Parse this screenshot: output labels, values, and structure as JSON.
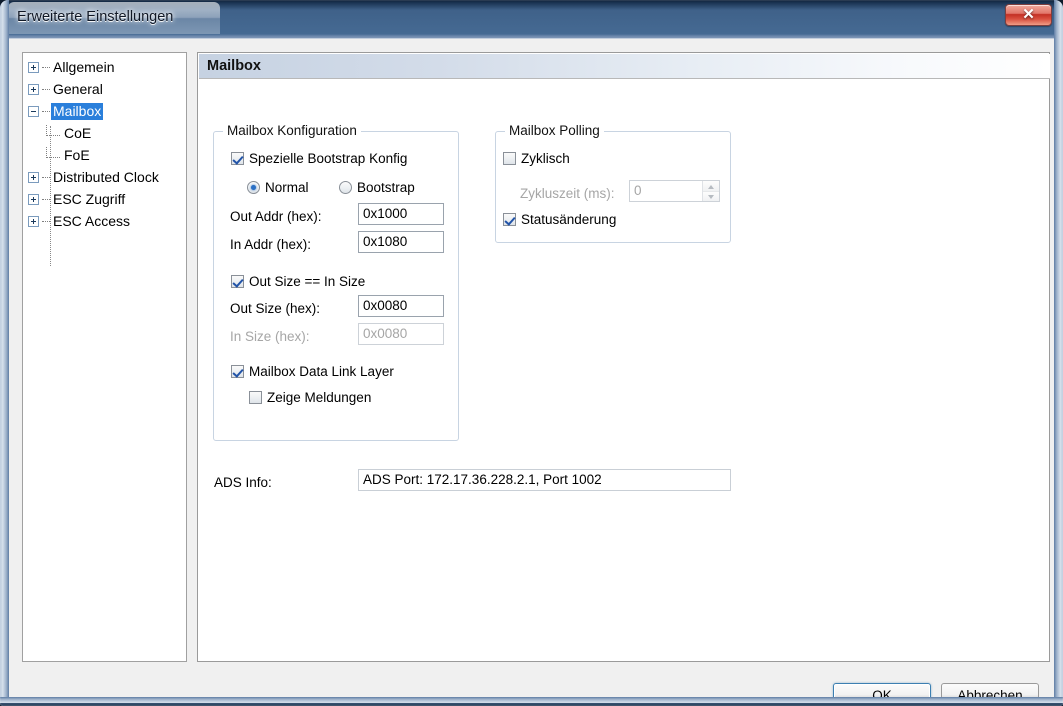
{
  "window": {
    "title": "Erweiterte Einstellungen",
    "close_glyph": "✕",
    "close_label": "Schließen"
  },
  "tree": {
    "items": [
      {
        "label": "Allgemein",
        "state": "collapsed",
        "level": 0,
        "selected": false
      },
      {
        "label": "General",
        "state": "collapsed",
        "level": 0,
        "selected": false
      },
      {
        "label": "Mailbox",
        "state": "expanded",
        "level": 0,
        "selected": true
      },
      {
        "label": "CoE",
        "state": "leaf",
        "level": 1,
        "selected": false
      },
      {
        "label": "FoE",
        "state": "leaf",
        "level": 1,
        "selected": false
      },
      {
        "label": "Distributed Clock",
        "state": "collapsed",
        "level": 0,
        "selected": false
      },
      {
        "label": "ESC Zugriff",
        "state": "collapsed",
        "level": 0,
        "selected": false
      },
      {
        "label": "ESC Access",
        "state": "collapsed",
        "level": 0,
        "selected": false
      }
    ]
  },
  "content": {
    "header_title": "Mailbox",
    "konfiguration": {
      "group_title": "Mailbox Konfiguration",
      "spezielle_bootstrap_konfig": {
        "label": "Spezielle Bootstrap Konfig",
        "checked": true
      },
      "mode": {
        "normal": {
          "label": "Normal",
          "selected": true
        },
        "bootstrap": {
          "label": "Bootstrap",
          "selected": false
        }
      },
      "out_addr": {
        "label": "Out Addr (hex):",
        "value": "0x1000",
        "disabled": false
      },
      "in_addr": {
        "label": "In Addr (hex):",
        "value": "0x1080",
        "disabled": false
      },
      "out_size_eq_in_size": {
        "label": "Out Size == In Size",
        "checked": true
      },
      "out_size": {
        "label": "Out Size (hex):",
        "value": "0x0080",
        "disabled": false
      },
      "in_size": {
        "label": "In Size (hex):",
        "value": "0x0080",
        "disabled": true
      },
      "mailbox_data_link_layer": {
        "label": "Mailbox Data Link Layer",
        "checked": true
      },
      "zeige_meldungen": {
        "label": "Zeige Meldungen",
        "checked": false
      }
    },
    "polling": {
      "group_title": "Mailbox Polling",
      "zyklisch": {
        "label": "Zyklisch",
        "checked": false
      },
      "zykluszeit": {
        "label": "Zykluszeit (ms):",
        "value": "0",
        "disabled": true
      },
      "statusaenderung": {
        "label": "Statusänderung",
        "checked": true
      }
    },
    "ads_info": {
      "label": "ADS Info:",
      "value": "ADS Port: 172.17.36.228.2.1, Port 1002"
    }
  },
  "footer": {
    "ok_label": "OK",
    "cancel_label": "Abbrechen"
  },
  "colors": {
    "titlebar": "#456a93",
    "selection": "#2a7fdb",
    "close_button": "#c32f24",
    "default_button_border": "#3c7fb1",
    "client_background": "#f0f0f0",
    "panel_background": "#ffffff"
  }
}
